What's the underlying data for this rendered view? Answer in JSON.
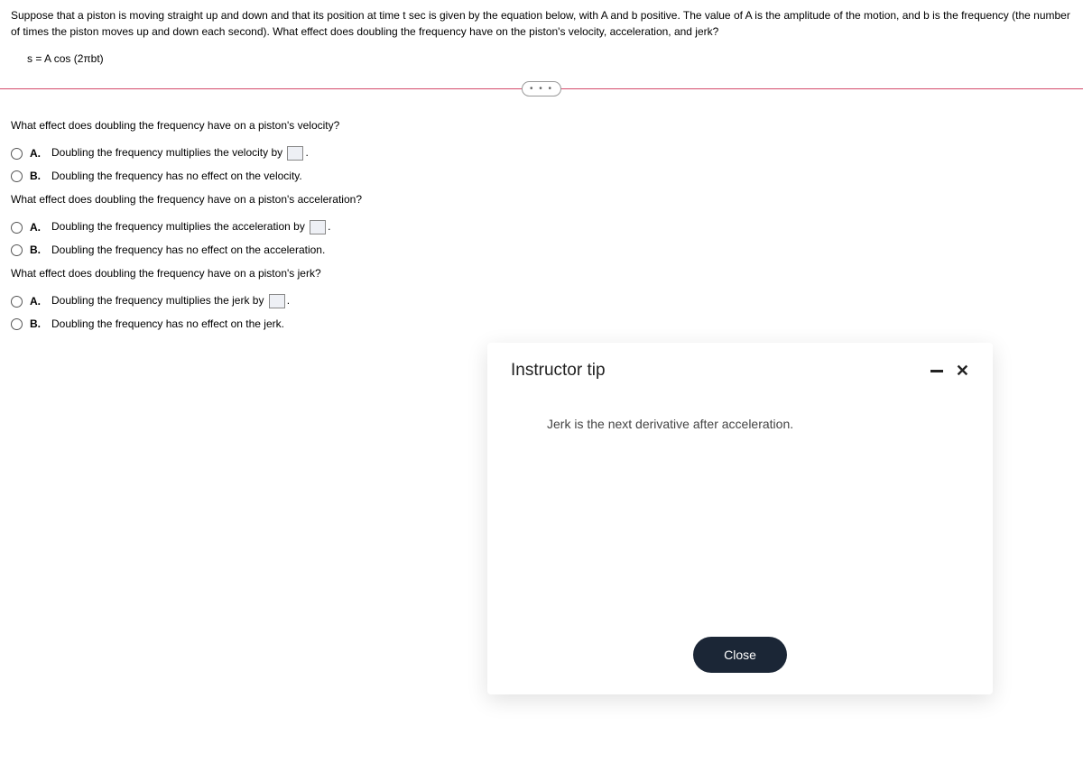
{
  "problem": {
    "statement": "Suppose that a piston is moving straight up and down and that its position at time t sec is given by the equation below, with A and b positive. The value of A is the amplitude of the motion, and b is the frequency (the number of times the piston moves up and down each second). What effect does doubling the frequency have on the piston's velocity, acceleration, and jerk?",
    "equation": "s = A cos (2πbt)"
  },
  "pill": "• • •",
  "questions": {
    "velocity": {
      "prompt": "What effect does doubling the frequency have on a piston's velocity?",
      "optA_pre": "Doubling the frequency multiplies the velocity by ",
      "optA_post": ".",
      "optB": "Doubling the frequency has no effect on the velocity."
    },
    "acceleration": {
      "prompt": "What effect does doubling the frequency have on a piston's acceleration?",
      "optA_pre": "Doubling the frequency multiplies the acceleration by ",
      "optA_post": ".",
      "optB": "Doubling the frequency has no effect on the acceleration."
    },
    "jerk": {
      "prompt": "What effect does doubling the frequency have on a piston's jerk?",
      "optA_pre": "Doubling the frequency multiplies the jerk by ",
      "optA_post": ".",
      "optB": "Doubling the frequency has no effect on the jerk."
    }
  },
  "labels": {
    "A": "A.",
    "B": "B."
  },
  "modal": {
    "title": "Instructor tip",
    "body": "Jerk is the next derivative after acceleration.",
    "close": "Close"
  }
}
